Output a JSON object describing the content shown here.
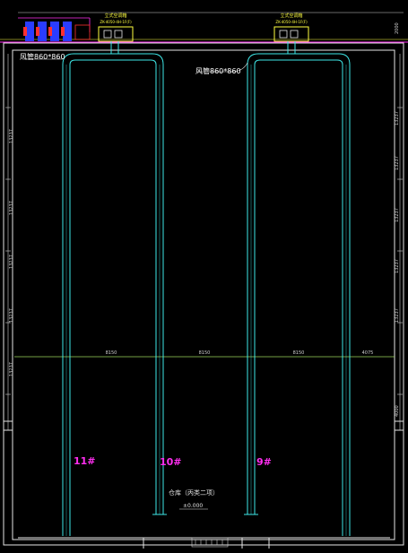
{
  "units": [
    {
      "title": "立式空调箱",
      "model": "ZK-4050-4H-1F(F)"
    },
    {
      "title": "立式空调箱",
      "model": "ZK-4050-4H-1F(F)"
    }
  ],
  "duct_labels": {
    "left": "风管860*860",
    "right": "风管860*860"
  },
  "branch_labels": [
    "11#",
    "10#",
    "9#"
  ],
  "room": {
    "name": "仓库（丙类二项）",
    "elevation": "±0.000"
  },
  "dims": {
    "top_right": "2000",
    "mid": [
      "8150",
      "8150",
      "8150",
      "4075"
    ],
    "left": [
      "13237",
      "13237",
      "13237",
      "13237",
      "13237"
    ],
    "right": [
      "13237",
      "13237",
      "13237",
      "13237",
      "13237"
    ],
    "right_low": "4000"
  },
  "colors": {
    "duct": "#3ee8e8",
    "wall": "#e8e8e8",
    "grid": "#9bd45c",
    "magenta": "#ff2ef0",
    "yellow": "#ffff40",
    "blue": "#2a3cff",
    "red": "#ff3030"
  }
}
